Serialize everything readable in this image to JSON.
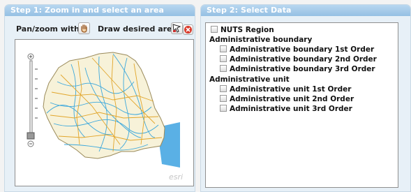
{
  "step1": {
    "title": "Step 1: Zoom in and select an area",
    "pan_zoom_label": "Pan/zoom with",
    "draw_area_label": "Draw desired area:",
    "map_attribution": "esri",
    "icons": [
      "hand-icon",
      "draw-area-icon",
      "clear-selection-icon"
    ]
  },
  "step2": {
    "title": "Step 2: Select Data",
    "nuts_region": "NUTS Region",
    "groups": [
      {
        "heading": "Administrative boundary",
        "items": [
          "Administrative boundary 1st Order",
          "Administrative boundary 2nd Order",
          "Administrative boundary 3rd Order"
        ]
      },
      {
        "heading": "Administrative unit",
        "items": [
          "Administrative unit 1st Order",
          "Administrative unit 2nd Order",
          "Administrative unit 3rd Order"
        ]
      }
    ]
  },
  "colors": {
    "header": "#9fc6e8",
    "panel": "#e7f0f7",
    "sea": "#4aa3df",
    "river": "#39a6d8",
    "road": "#e2a629"
  }
}
